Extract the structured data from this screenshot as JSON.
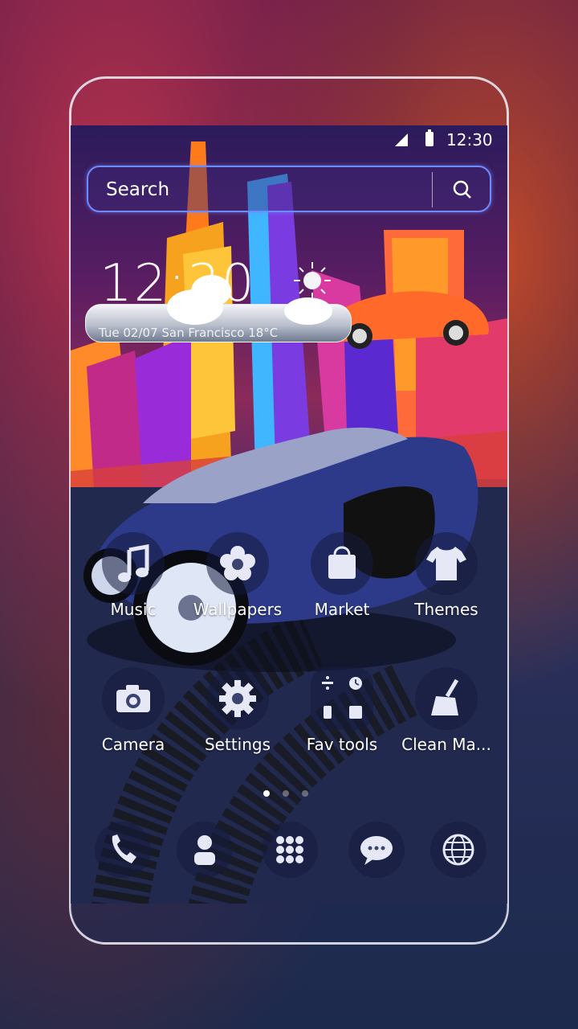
{
  "status_bar": {
    "time": "12:30"
  },
  "search": {
    "placeholder": "Search"
  },
  "clock_widget": {
    "time": "12:30",
    "info": "Tue  02/07  San Francisco       18°C"
  },
  "apps_row1": [
    {
      "label": "Music",
      "icon": "music-note-icon"
    },
    {
      "label": "Wallpapers",
      "icon": "flower-icon"
    },
    {
      "label": "Market",
      "icon": "shopping-bag-icon"
    },
    {
      "label": "Themes",
      "icon": "tshirt-icon"
    }
  ],
  "apps_row2": [
    {
      "label": "Camera",
      "icon": "camera-icon"
    },
    {
      "label": "Settings",
      "icon": "gear-icon"
    },
    {
      "label": "Fav tools",
      "icon": "tools-grid-icon"
    },
    {
      "label": "Clean Ma...",
      "icon": "broom-icon"
    }
  ],
  "dock": [
    {
      "icon": "phone-icon"
    },
    {
      "icon": "contacts-icon"
    },
    {
      "icon": "app-drawer-icon"
    },
    {
      "icon": "messages-icon"
    },
    {
      "icon": "browser-globe-icon"
    }
  ],
  "page_indicator": {
    "current": 1,
    "total": 3
  }
}
